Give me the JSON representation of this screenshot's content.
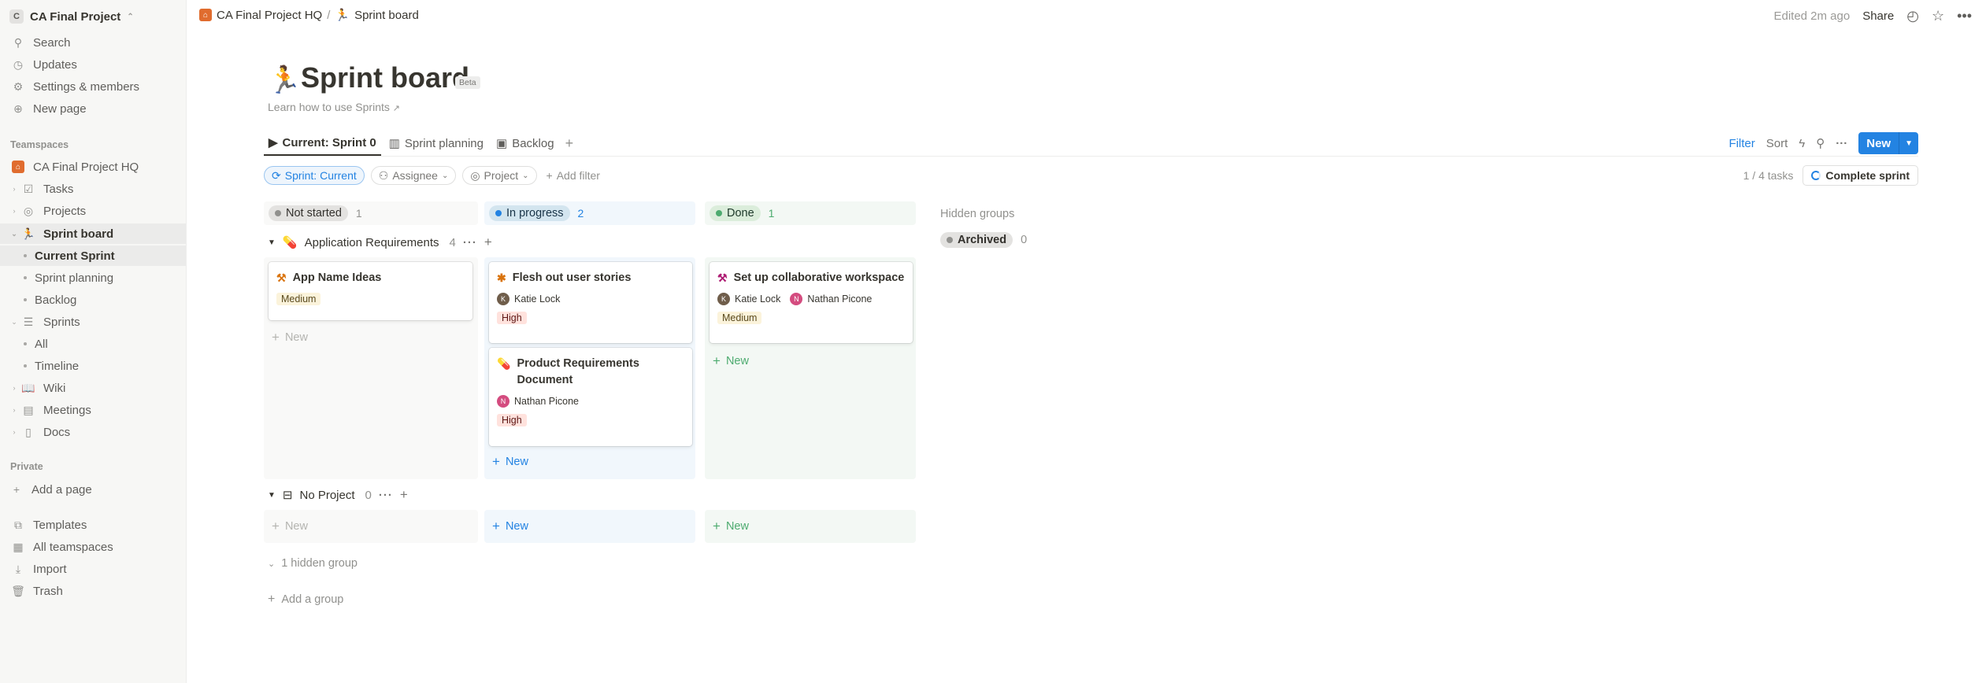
{
  "workspace": {
    "initial": "C",
    "name": "CA Final Project"
  },
  "sidebar": {
    "top_items": [
      {
        "label": "Search",
        "icon": "search-icon"
      },
      {
        "label": "Updates",
        "icon": "clock-icon"
      },
      {
        "label": "Settings & members",
        "icon": "gear-icon"
      },
      {
        "label": "New page",
        "icon": "plus-circle-icon"
      }
    ],
    "teamspaces_label": "Teamspaces",
    "teamspace_name": "CA Final Project HQ",
    "tree": {
      "tasks": "Tasks",
      "projects": "Projects",
      "sprint_board": "Sprint board",
      "current_sprint": "Current Sprint",
      "sprint_planning": "Sprint planning",
      "backlog": "Backlog",
      "sprints": "Sprints",
      "all": "All",
      "timeline": "Timeline",
      "wiki": "Wiki",
      "meetings": "Meetings",
      "docs": "Docs"
    },
    "private_label": "Private",
    "add_page": "Add a page",
    "bottom_items": [
      {
        "label": "Templates",
        "icon": "templates-icon"
      },
      {
        "label": "All teamspaces",
        "icon": "teamspaces-icon"
      },
      {
        "label": "Import",
        "icon": "import-icon"
      },
      {
        "label": "Trash",
        "icon": "trash-icon"
      }
    ]
  },
  "topbar": {
    "crumb_1": "CA Final Project HQ",
    "crumb_sep": "/",
    "crumb_2": "Sprint board",
    "edited": "Edited 2m ago",
    "share": "Share"
  },
  "page": {
    "title": "Sprint board",
    "badge": "Beta",
    "learn_link": "Learn how to use Sprints"
  },
  "views": {
    "tabs": [
      "Current: Sprint 0",
      "Sprint planning",
      "Backlog"
    ],
    "filter": "Filter",
    "sort": "Sort",
    "new": "New"
  },
  "filters": {
    "sprint": "Sprint: Current",
    "assignee": "Assignee",
    "project": "Project",
    "add": "Add filter",
    "tasks_count": "1 / 4 tasks",
    "complete": "Complete sprint"
  },
  "board": {
    "columns": [
      {
        "label": "Not started",
        "count": "1",
        "color": "#91918e"
      },
      {
        "label": "In progress",
        "count": "2",
        "color": "#2383e2"
      },
      {
        "label": "Done",
        "count": "1",
        "color": "#4dab6f"
      }
    ],
    "groups": [
      {
        "name": "Application Requirements",
        "count": "4",
        "cards": {
          "not_started": [
            {
              "title": "App Name Ideas",
              "priority": "Medium"
            }
          ],
          "in_progress": [
            {
              "title": "Flesh out user stories",
              "assignee": "Katie Lock",
              "priority": "High"
            },
            {
              "title": "Product Requirements Document",
              "assignee": "Nathan Picone",
              "priority": "High"
            }
          ],
          "done": [
            {
              "title": "Set up collaborative workspace",
              "assignees": [
                "Katie Lock",
                "Nathan Picone"
              ],
              "priority": "Medium"
            }
          ]
        }
      },
      {
        "name": "No Project",
        "count": "0"
      }
    ],
    "new_label": "New",
    "hidden_groups_label": "Hidden groups",
    "archived_label": "Archived",
    "archived_count": "0",
    "hidden_group_toggle": "1 hidden group",
    "add_group": "Add a group"
  },
  "colors": {
    "accent": "#2383e2",
    "sidebar_bg": "#f7f7f5",
    "not_started_bg": "#f9f9f8",
    "in_progress_bg": "#f1f7fc",
    "done_bg": "#f3f8f4"
  }
}
